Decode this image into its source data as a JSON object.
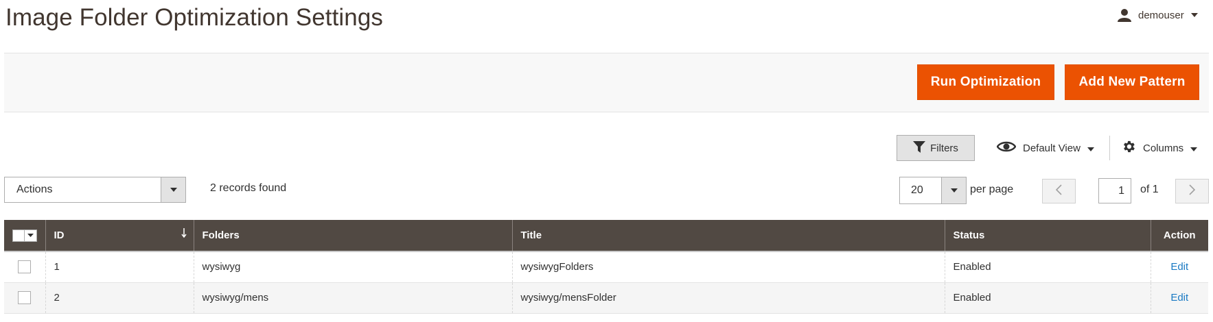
{
  "header": {
    "title": "Image Folder Optimization Settings",
    "user": "demouser"
  },
  "actions_bar": {
    "run_optimization": "Run Optimization",
    "add_new_pattern": "Add New Pattern"
  },
  "controls": {
    "filters": "Filters",
    "default_view": "Default View",
    "columns": "Columns",
    "actions_select": "Actions",
    "records_found": "2 records found",
    "per_page_value": "20",
    "per_page_label": "per page",
    "current_page": "1",
    "of_pages": "of 1"
  },
  "table": {
    "columns": [
      "ID",
      "Folders",
      "Title",
      "Status",
      "Action"
    ],
    "rows": [
      {
        "id": "1",
        "folders": "wysiwyg",
        "title": "wysiwygFolders",
        "status": "Enabled",
        "action": "Edit"
      },
      {
        "id": "2",
        "folders": "wysiwyg/mens",
        "title": "wysiwyg/mensFolder",
        "status": "Enabled",
        "action": "Edit"
      }
    ]
  },
  "colors": {
    "accent": "#eb5202",
    "table_header": "#514943",
    "link": "#1979c3"
  },
  "icons": {
    "user": "user-icon",
    "filter": "filter-icon",
    "view": "eye-icon",
    "columns": "gear-icon",
    "sort": "arrow-down-icon",
    "prev": "chevron-left-icon",
    "next": "chevron-right-icon"
  }
}
